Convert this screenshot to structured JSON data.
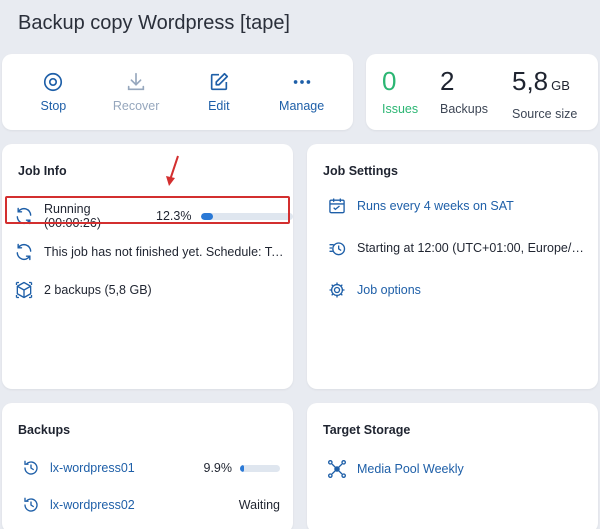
{
  "page": {
    "title": "Backup copy Wordpress [tape]"
  },
  "toolbar": {
    "stop": "Stop",
    "recover": "Recover",
    "edit": "Edit",
    "manage": "Manage"
  },
  "stats": {
    "issues": {
      "value": "0",
      "label": "Issues"
    },
    "backups": {
      "value": "2",
      "label": "Backups"
    },
    "source": {
      "value": "5,8",
      "unit": "GB",
      "label": "Source size"
    }
  },
  "job_info": {
    "title": "Job Info",
    "running": {
      "status": "Running (00:00:26)",
      "percent": "12.3%",
      "progress": 0.123
    },
    "schedule_note": "This job has not finished yet. Schedule: Tape …",
    "backups_summary": "2 backups (5,8 GB)"
  },
  "job_settings": {
    "title": "Job Settings",
    "runs": "Runs every 4 weeks on SAT",
    "starting": "Starting at 12:00 (UTC+01:00, Europe/Am…",
    "options": "Job options"
  },
  "backups": {
    "title": "Backups",
    "items": [
      {
        "name": "lx-wordpress01",
        "status": "9.9%",
        "progress": 0.099
      },
      {
        "name": "lx-wordpress02",
        "status": "Waiting"
      }
    ]
  },
  "target_storage": {
    "title": "Target Storage",
    "pool": "Media Pool Weekly"
  },
  "colors": {
    "accent": "#1e5fa8",
    "success": "#2bb673",
    "highlight": "#d32f2f",
    "progress": "#2a79d6"
  }
}
